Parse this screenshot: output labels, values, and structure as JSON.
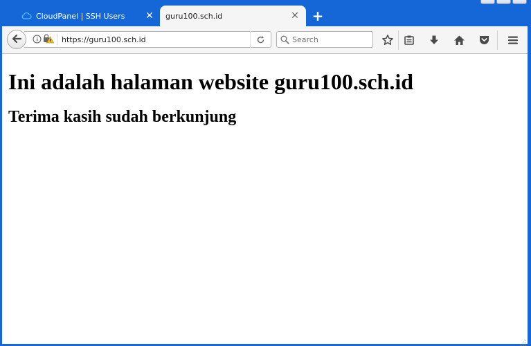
{
  "tabs": [
    {
      "title": "CloudPanel | SSH Users",
      "icon": "cloud-icon",
      "active": false
    },
    {
      "title": "guru100.sch.id",
      "icon": "",
      "active": true
    }
  ],
  "toolbar": {
    "url": "https://guru100.sch.id",
    "search_placeholder": "Search",
    "buttons": [
      "back-arrow-icon",
      "reload-icon",
      "bookmark-star-icon",
      "reading-list-icon",
      "download-icon",
      "home-icon",
      "pocket-icon",
      "menu-icon"
    ]
  },
  "page": {
    "heading": "Ini adalah halaman website guru100.sch.id",
    "subheading": "Terima kasih sudah berkunjung"
  },
  "colors": {
    "titlebar": "#1566d6",
    "toolbar": "#f5f5f5",
    "content_bg": "#ffffff",
    "warning_triangle": "#f4c20d"
  }
}
